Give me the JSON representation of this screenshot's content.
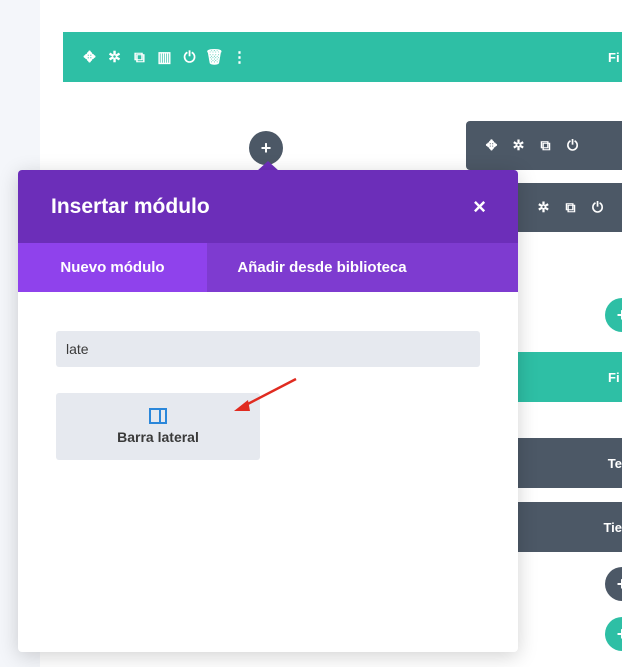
{
  "row_toolbar": {
    "icons": [
      "move-icon",
      "gear-icon",
      "duplicate-icon",
      "columns-icon",
      "power-icon",
      "trash-icon",
      "more-icon"
    ],
    "label": "Fi"
  },
  "module_toolbar_1": {
    "icons": [
      "move-icon",
      "gear-icon",
      "duplicate-icon",
      "power-icon"
    ]
  },
  "module_toolbar_2": {
    "icons": [
      "gear-icon",
      "duplicate-icon",
      "power-icon"
    ]
  },
  "add_button": {
    "symbol": "+"
  },
  "right_rows": {
    "teal_label": "Fi",
    "bar1": "Te",
    "bar2": "Tie"
  },
  "modal": {
    "title": "Insertar módulo",
    "close": "×",
    "tabs": [
      {
        "label": "Nuevo módulo",
        "active": true
      },
      {
        "label": "Añadir desde biblioteca",
        "active": false
      }
    ],
    "search": {
      "value": "late",
      "placeholder": ""
    },
    "result": {
      "label": "Barra lateral",
      "icon": "sidebar-icon"
    }
  },
  "colors": {
    "modal_header": "#6c2eb9",
    "tabs_bg": "#7e3bd0",
    "tab_active": "#8f42ec",
    "teal": "#2ebfa5",
    "dark": "#4c5866",
    "arrow": "#e02b20"
  }
}
